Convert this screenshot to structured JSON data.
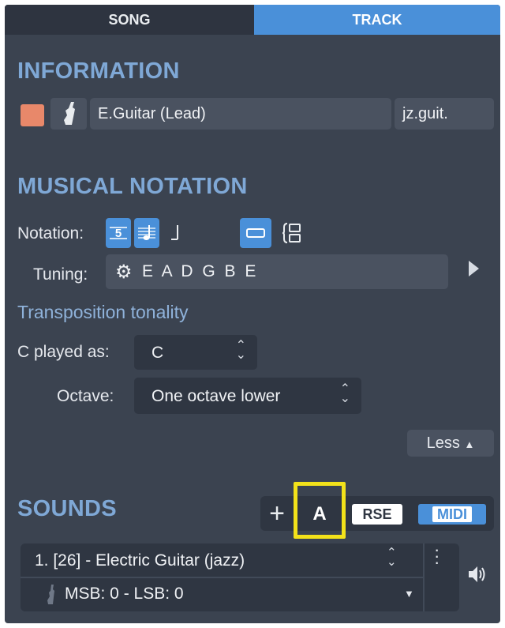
{
  "tabs": {
    "song": "SONG",
    "track": "TRACK"
  },
  "information": {
    "title": "INFORMATION",
    "color_swatch": "#e8886a",
    "instrument_icon": "guitar-icon",
    "track_name": "E.Guitar (Lead)",
    "short_name": "jz.guit."
  },
  "notation": {
    "title": "MUSICAL NOTATION",
    "label": "Notation:",
    "btn_tab_glyph": "5",
    "tuning_label": "Tuning:",
    "tuning_value": "E A D G B E"
  },
  "transposition": {
    "heading": "Transposition tonality",
    "c_played_label": "C played as:",
    "c_played_value": "C",
    "octave_label": "Octave:",
    "octave_value": "One octave lower"
  },
  "less_button": "Less",
  "sounds": {
    "title": "SOUNDS",
    "add_glyph": "+",
    "auto_label": "A",
    "rse_label": "RSE",
    "midi_label": "MIDI",
    "sound_name": "1. [26] - Electric Guitar (jazz)",
    "bank": "MSB: 0 - LSB: 0"
  },
  "colors": {
    "accent": "#4a90d9",
    "highlight": "#f3e21a",
    "section_title": "#7fa8d6"
  }
}
